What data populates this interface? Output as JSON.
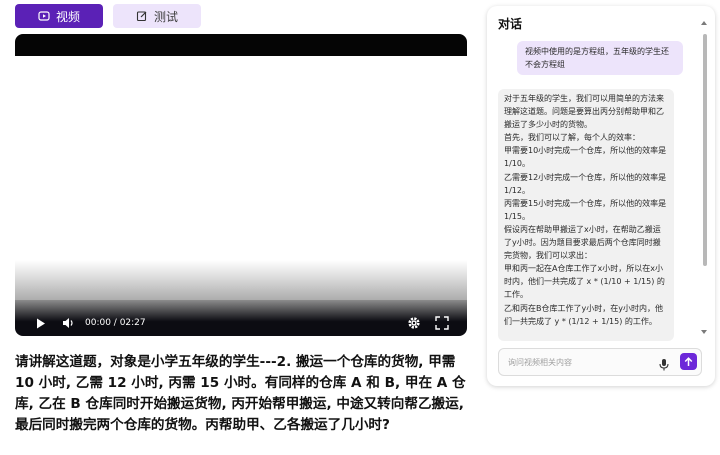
{
  "tabs": [
    {
      "label": "视频",
      "icon": "play-video-icon",
      "active": true
    },
    {
      "label": "测试",
      "icon": "edit-square-icon",
      "active": false
    }
  ],
  "video": {
    "time_display": "00:00 / 02:27",
    "current_time": "00:00",
    "duration": "02:27",
    "progress": 0
  },
  "question": "请讲解这道题，对象是小学五年级的学生---2. 搬运一个仓库的货物, 甲需 10 小时, 乙需 12 小时, 丙需 15 小时。有同样的仓库 A 和 B, 甲在 A 仓库, 乙在 B 仓库同时开始搬运货物, 丙开始帮甲搬运, 中途又转向帮乙搬运, 最后同时搬完两个仓库的货物。丙帮助甲、乙各搬运了几小时?",
  "chat": {
    "title": "对话",
    "user_message": "视频中使用的是方程组，五年级的学生还不会方程组",
    "assistant_lines": [
      "对于五年级的学生，我们可以用简单的方法来理解这道题。问题是要算出丙分别帮助甲和乙搬运了多少小时的货物。",
      "首先，我们可以了解，每个人的效率：",
      "甲需要10小时完成一个仓库，所以他的效率是1/10。",
      "乙需要12小时完成一个仓库，所以他的效率是1/12。",
      "丙需要15小时完成一个仓库，所以他的效率是1/15。",
      "假设丙在帮助甲搬运了x小时，在帮助乙搬运了y小时。因为题目要求最后两个仓库同时搬完货物，我们可以求出：",
      "甲和丙一起在A仓库工作了x小时，所以在x小时内，他们一共完成了 x * (1/10 + 1/15) 的工作。",
      "乙和丙在B仓库工作了y小时，在y小时内，他们一共完成了 y * (1/12 + 1/15) 的工作。"
    ],
    "input_placeholder": "询问视频相关内容"
  },
  "colors": {
    "accent": "#5b21b6",
    "tab_inactive": "#ede4fb",
    "send": "#6d28d9"
  }
}
